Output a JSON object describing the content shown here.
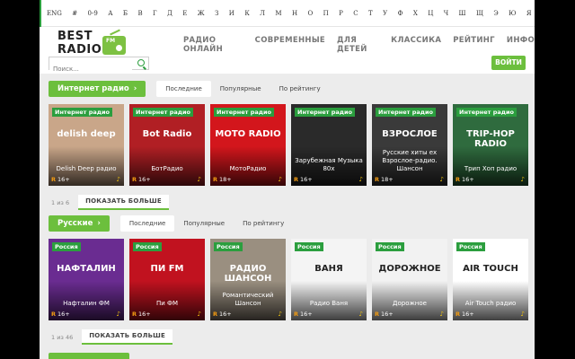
{
  "alphabet": [
    "ENG",
    "#",
    "0-9",
    "А",
    "Б",
    "В",
    "Г",
    "Д",
    "Е",
    "Ж",
    "З",
    "И",
    "К",
    "Л",
    "М",
    "Н",
    "О",
    "П",
    "Р",
    "С",
    "Т",
    "У",
    "Ф",
    "Х",
    "Ц",
    "Ч",
    "Ш",
    "Щ",
    "Э",
    "Ю",
    "Я"
  ],
  "logo": {
    "line1": "BEST",
    "line2": "RADIO",
    "badge": "FM"
  },
  "nav": [
    "РАДИО ОНЛАЙН",
    "СОВРЕМЕННЫЕ",
    "ДЛЯ ДЕТЕЙ",
    "КЛАССИКА",
    "РЕЙТИНГ",
    "ИНФО"
  ],
  "search": {
    "placeholder": "Поиск..."
  },
  "login_label": "ВОЙТИ",
  "sections": [
    {
      "title": "Интернет радио",
      "tabs": [
        "Последние",
        "Популярные",
        "По рейтингу"
      ],
      "active_tab": 0,
      "pages": "1 из 6",
      "more_label": "ПОКАЗАТЬ БОЛЬШЕ",
      "cards": [
        {
          "tag": "Интернет радио",
          "art": "delish deep",
          "name": "Delish Deep радио",
          "age": "16+",
          "bg": "#c9a689"
        },
        {
          "tag": "Интернет радио",
          "art": "Bot Radio",
          "name": "БотРадио",
          "age": "16+",
          "bg": "#b11f24"
        },
        {
          "tag": "Интернет радио",
          "art": "MOTO RADIO",
          "name": "МотоРадио",
          "age": "18+",
          "bg": "#d3161c"
        },
        {
          "tag": "Интернет радио",
          "art": "",
          "name": "Зарубежная Музыка 80х",
          "age": "16+",
          "bg": "#2a2a2a"
        },
        {
          "tag": "Интернет радио",
          "art": "ВЗРОСЛОЕ",
          "name": "Русские хиты ex Взрослое-радио. Шансон",
          "age": "18+",
          "bg": "#3a3a3a"
        },
        {
          "tag": "Интернет радио",
          "art": "TRIP-HOP RADIO",
          "name": "Трип Хоп радио",
          "age": "16+",
          "bg": "#2f6b3e"
        }
      ]
    },
    {
      "title": "Русские",
      "tabs": [
        "Последние",
        "Популярные",
        "По рейтингу"
      ],
      "active_tab": 0,
      "pages": "1 из 46",
      "more_label": "ПОКАЗАТЬ БОЛЬШЕ",
      "cards": [
        {
          "tag": "Россия",
          "art": "НАФТАЛИН",
          "name": "Нафталин ФМ",
          "age": "16+",
          "bg": "#6a2c91"
        },
        {
          "tag": "Россия",
          "art": "ПИ FM",
          "name": "Пи ФМ",
          "age": "16+",
          "bg": "#c1121f"
        },
        {
          "tag": "Россия",
          "art": "РАДИО ШАНСОН",
          "name": "Романтический Шансон",
          "age": "16+",
          "bg": "#9a8f80"
        },
        {
          "tag": "Россия",
          "art": "ВАНЯ",
          "name": "Радио Ваня",
          "age": "16+",
          "bg": "#f4f4f4"
        },
        {
          "tag": "Россия",
          "art": "ДОРОЖНОЕ",
          "name": "Дорожное",
          "age": "16+",
          "bg": "#f2f2f2"
        },
        {
          "tag": "Россия",
          "art": "AIR TOUCH",
          "name": "Air Touch радио",
          "age": "16+",
          "bg": "#ffffff"
        }
      ]
    }
  ],
  "colors": {
    "accent": "#6cbf3d",
    "tag": "#2b9e3e"
  }
}
